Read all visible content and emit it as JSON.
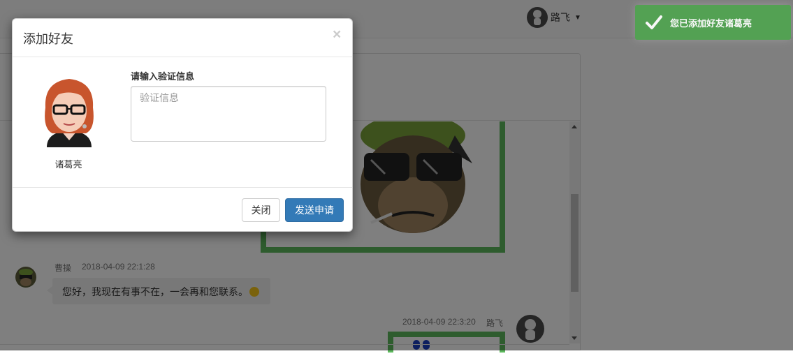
{
  "nav": {
    "username": "路飞",
    "user_icon": "user-avatar-icon",
    "dropdown_icon": "caret-down-icon"
  },
  "chat": {
    "messages": [
      {
        "sender": "曹操",
        "time": "2018-04-09 22:1:28",
        "text": "您好，我现在有事不在，一会再和您联系。",
        "emoji": "smile-emoji"
      },
      {
        "sender": "路飞",
        "time": "2018-04-09 22:3:20"
      }
    ]
  },
  "modal": {
    "title": "添加好友",
    "close_symbol": "×",
    "friend_name": "诸葛亮",
    "verify_label": "请输入验证信息",
    "verify_placeholder": "验证信息",
    "verify_value": "",
    "close_button": "关闭",
    "send_button": "发送申请"
  },
  "toast": {
    "message": "您已添加好友诸葛亮",
    "icon": "checkmark-icon",
    "color": "#51a351"
  },
  "colors": {
    "primary": "#337ab7",
    "accent_green": "#5cb85c"
  }
}
